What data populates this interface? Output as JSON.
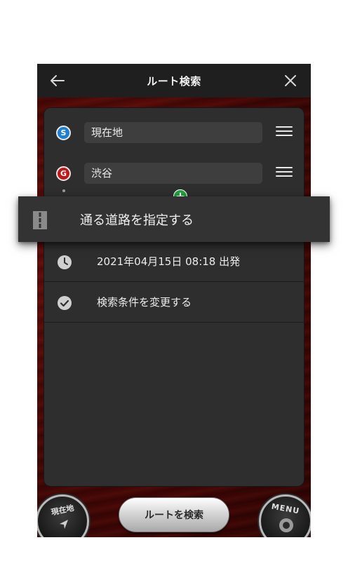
{
  "header": {
    "title": "ルート検索",
    "back_icon": "back-arrow-icon",
    "close_icon": "close-icon"
  },
  "route": {
    "start": {
      "badge": "S",
      "value": "現在地",
      "badge_color": "#1f7fcf"
    },
    "goal": {
      "badge": "G",
      "value": "渋谷",
      "badge_color": "#c01818"
    },
    "add_via_icon": "plus-circle-icon",
    "reorder_icon": "drag-handle-icon"
  },
  "options": [
    {
      "label": "2021年04月15日 08:18 出発",
      "icon": "clock-icon"
    },
    {
      "label": "検索条件を変更する",
      "icon": "check-circle-icon"
    }
  ],
  "popup": {
    "label": "通る道路を指定する",
    "icon": "road-icon"
  },
  "bottom": {
    "search_button": "ルートを検索",
    "current_location_button": "現在地",
    "menu_button": "MENU"
  },
  "colors": {
    "accent_green": "#22a041",
    "header_bg": "#1f1f1f",
    "panel_bg": "#2e2e2e",
    "wood": "#5a0a07"
  }
}
